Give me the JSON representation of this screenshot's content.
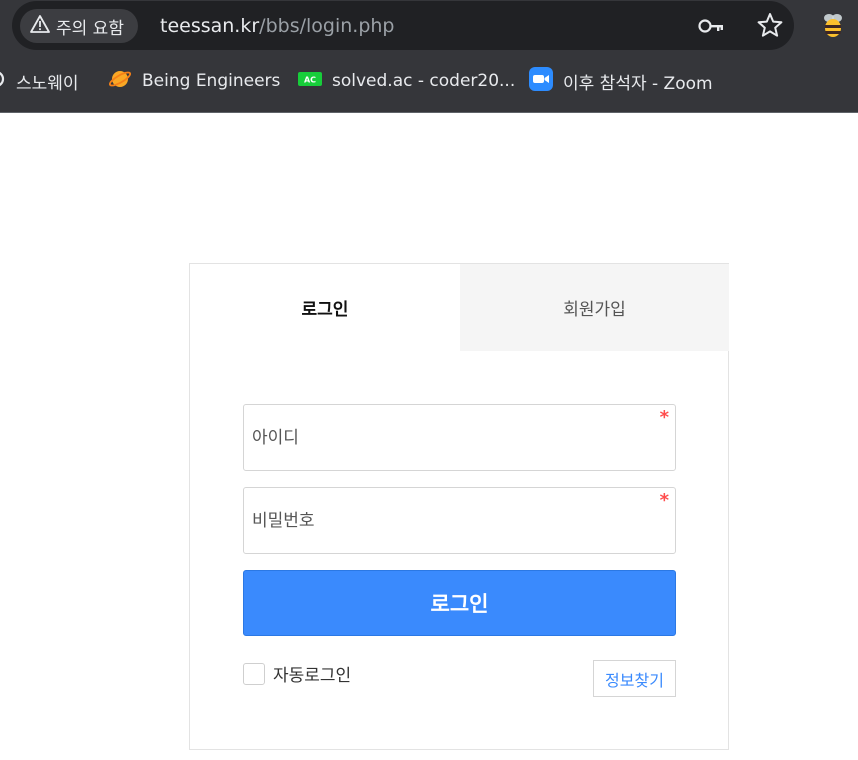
{
  "browser": {
    "security_label": "주의 요함",
    "url_host": "teessan.kr",
    "url_path": "/bbs/login.php",
    "icons": {
      "warning": "warning-triangle-icon",
      "password_key": "key-icon",
      "bookmark_star": "star-icon",
      "extension": "bee-extension-icon"
    }
  },
  "bookmarks": [
    {
      "label": "스노웨이",
      "icon": "partial-circle-icon"
    },
    {
      "label": "Being Engineers",
      "icon": "planet-icon",
      "color": "#f9a825"
    },
    {
      "label": "solved.ac - coder20...",
      "icon": "ac-badge-icon",
      "color": "#17ce3a"
    },
    {
      "label": "이후 참석자 - Zoom",
      "icon": "zoom-icon",
      "color": "#2d8cff"
    }
  ],
  "login": {
    "tabs": {
      "login": "로그인",
      "join": "회원가입"
    },
    "id_placeholder": "아이디",
    "password_placeholder": "비밀번호",
    "required_mark": "*",
    "submit_label": "로그인",
    "auto_login_label": "자동로그인",
    "find_info_label": "정보찾기"
  },
  "colors": {
    "primary": "#3a8afd",
    "required": "#ff4d4d",
    "chrome_bg": "#35363a"
  }
}
